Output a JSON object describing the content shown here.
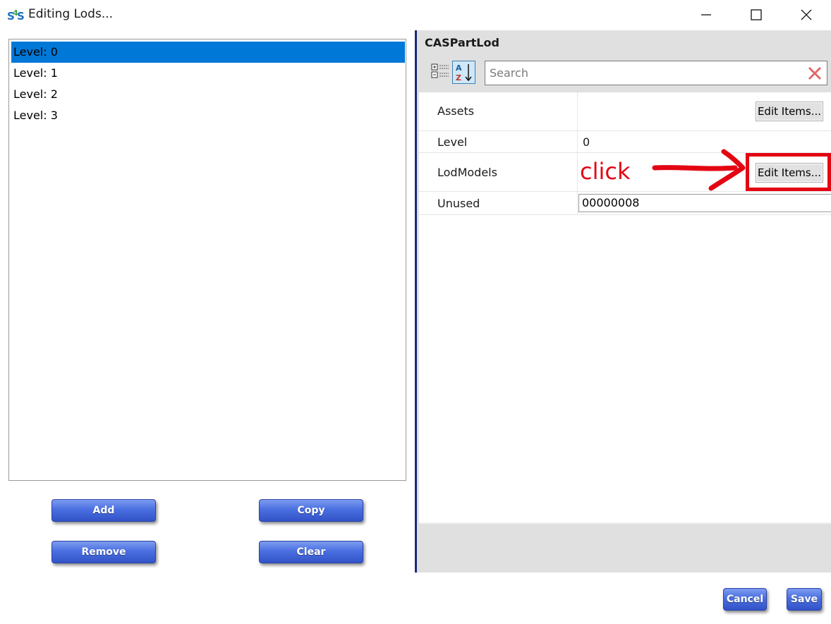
{
  "window": {
    "title": "Editing Lods...",
    "icon": "s4s-app-icon",
    "controls": [
      "minimize-icon",
      "maximize-icon",
      "close-icon"
    ]
  },
  "lod_list": {
    "items": [
      {
        "label": "Level: 0",
        "selected": true
      },
      {
        "label": "Level: 1",
        "selected": false
      },
      {
        "label": "Level: 2",
        "selected": false
      },
      {
        "label": "Level: 3",
        "selected": false
      }
    ]
  },
  "list_buttons": {
    "add": "Add",
    "copy": "Copy",
    "remove": "Remove",
    "clear": "Clear"
  },
  "property_grid": {
    "header": "CASPartLod",
    "search_placeholder": "Search",
    "rows": [
      {
        "name": "Assets",
        "button": "Edit Items..."
      },
      {
        "name": "Level",
        "value": "0"
      },
      {
        "name": "LodModels",
        "button": "Edit Items..."
      },
      {
        "name": "Unused",
        "value": "00000008"
      }
    ]
  },
  "annotation": {
    "text": "click",
    "color": "#e30613"
  },
  "dialog_buttons": {
    "cancel": "Cancel",
    "save": "Save"
  },
  "colors": {
    "selection": "#0078d7",
    "button_blue": "#4a6fe0",
    "annotation_red": "#e30613"
  }
}
